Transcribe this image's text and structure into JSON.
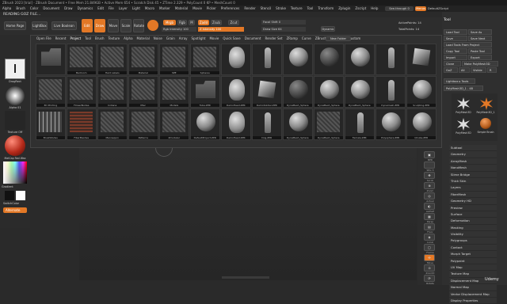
{
  "titlebar": "ZBrush 2023 [trial] - ZBrush Document  •  Free Mem 21.849GB • Active Mem 654 • Scratch Disk 45 • ZTime 2.329 • PolyCount 0 KP • MeshCount 0",
  "menu": [
    "Alpha",
    "Brush",
    "Color",
    "Document",
    "Draw",
    "Dynamics",
    "Edit",
    "File",
    "Layer",
    "Light",
    "Macro",
    "Marker",
    "Material",
    "Movie",
    "Picker",
    "Preferences",
    "Render",
    "Stencil",
    "Stroke",
    "Texture",
    "Tool",
    "Transform",
    "Zplugin",
    "Zscript",
    "Help"
  ],
  "menu_right": {
    "seethrough": "See-through 0",
    "menus": "Menus",
    "default_script": "DefaultZScript"
  },
  "notice": "READING GOZ FILE...",
  "topbar": {
    "home_page": "Home Page",
    "lightbox": "LightBox",
    "live_boolean": "Live Boolean",
    "edit": "Edit",
    "draw": "Draw",
    "move": "Move",
    "scale": "Scale",
    "rotate": "Rotate",
    "mrgb": "Mrgb",
    "rgb": "Rgb",
    "m": "M",
    "zadd": "Zadd",
    "zsub": "Zsub",
    "zcut": "Zcut",
    "rgb_intensity": "Rgb Intensity 100",
    "z_intensity": "Z Intensity 100",
    "focal_shift": "Focal Shift 0",
    "draw_size": "Draw Size 64",
    "dynamic": "Dynamic",
    "active_points": "ActivePoints: 14",
    "total_points": "TotalPoints: 14"
  },
  "lightbox": {
    "tabs": [
      "Open File",
      "Recent",
      "Project",
      "Tool",
      "Brush",
      "Texture",
      "Alpha",
      "Material",
      "Noise",
      "Grain",
      "Array",
      "Spotlight",
      "Movie",
      "Quick Save",
      "Document",
      "Render Set",
      "ZRamp",
      "Curve",
      "ZBrush",
      "Spotlight",
      "Custom"
    ],
    "active_tab": "Project",
    "new_folder": "New Folder",
    "items": [
      {
        "label": "",
        "kind": "folder"
      },
      {
        "label": "Bedroom",
        "kind": "tex"
      },
      {
        "label": "Hard Labels",
        "kind": "tex"
      },
      {
        "label": "Material",
        "kind": "tex"
      },
      {
        "label": "SPE",
        "kind": "tex"
      },
      {
        "label": "Spheres",
        "kind": "tex"
      },
      {
        "label": "",
        "kind": "head"
      },
      {
        "label": "",
        "kind": "figure"
      },
      {
        "label": "",
        "kind": "sphere"
      },
      {
        "label": "",
        "kind": "sphere"
      },
      {
        "label": "",
        "kind": "sphere"
      },
      {
        "label": "",
        "kind": "figure"
      },
      {
        "label": "",
        "kind": "cube"
      },
      {
        "label": "3D Printing",
        "kind": "tex"
      },
      {
        "label": "FlowerNodes",
        "kind": "tex"
      },
      {
        "label": "Indiana",
        "kind": "tex"
      },
      {
        "label": "Misc",
        "kind": "tex"
      },
      {
        "label": "Models",
        "kind": "tex"
      },
      {
        "label": "Tube.ZPR",
        "kind": "folder"
      },
      {
        "label": "DemoHead.ZPR",
        "kind": "head"
      },
      {
        "label": "DemoSoldier.ZPR",
        "kind": "cube"
      },
      {
        "label": "DynaMesh_Sphere",
        "kind": "sphere"
      },
      {
        "label": "DynaMesh_Sphere",
        "kind": "sphere"
      },
      {
        "label": "DynaMesh_Sphere",
        "kind": "sphere"
      },
      {
        "label": "Dynamesh.ZPR",
        "kind": "figure"
      },
      {
        "label": "Sculpting.ZPR",
        "kind": "sphere"
      },
      {
        "label": "BrushNodes",
        "kind": "brush"
      },
      {
        "label": "FiberMeshes",
        "kind": "red"
      },
      {
        "label": "Mannequin",
        "kind": "tex"
      },
      {
        "label": "Patterns",
        "kind": "tex"
      },
      {
        "label": "Zmodeler",
        "kind": "tex"
      },
      {
        "label": "DefaultProject.ZPR",
        "kind": "sphere"
      },
      {
        "label": "DemoHead.ZPR",
        "kind": "head"
      },
      {
        "label": "Dog.ZPR",
        "kind": "figure"
      },
      {
        "label": "DynaMesh_Sphere",
        "kind": "sphere"
      },
      {
        "label": "DynaMesh_Sphere",
        "kind": "tex"
      },
      {
        "label": "Female.ZPR",
        "kind": "figure"
      },
      {
        "label": "Polysphere.ZPR",
        "kind": "sphere"
      },
      {
        "label": "QCube.ZPR",
        "kind": "sphere"
      }
    ]
  },
  "leftshelf": {
    "stroke": "DragRect",
    "alpha": "Alpha 01",
    "texture": "Texture Off",
    "material": "MatCap Red Wax",
    "gradient": "Gradient",
    "switch_color": "SwitchColor",
    "alternate": "Alternate"
  },
  "rightpanel": {
    "title": "Tool",
    "buttons": [
      "Load Tool",
      "Save As",
      "Save",
      "Save Next",
      "Load Tools From Project",
      "Copy Tool",
      "Paste Tool",
      "Import",
      "Export",
      "Clone",
      "Make PolyMesh3D",
      "GoZ",
      "All",
      "Visible",
      "R",
      "Lightbox ▸ Tools",
      "PolyMesh3D_1 . 48"
    ],
    "tools": [
      "PolyMesh3D",
      "PolyMesh3D_1",
      "Simple Brush",
      "PolyMesh3D"
    ],
    "subpalettes": [
      "Subtool",
      "Geometry",
      "ArrayMesh",
      "NanoMesh",
      "Slime Bridge",
      "Thick Skin",
      "Layers",
      "FiberMesh",
      "Geometry HD",
      "Preview",
      "Surface",
      "Deformation",
      "Masking",
      "Visibility",
      "Polygroups",
      "Contact",
      "Morph Target",
      "Polypaint",
      "UV Map",
      "Texture Map",
      "Displacement Map",
      "Normal Map",
      "Vector Displacement Map",
      "Display Properties"
    ]
  },
  "rightshelf": [
    {
      "label": "BPR",
      "icon": "▣"
    },
    {
      "label": "SPix 3",
      "icon": ""
    },
    {
      "label": "Scroll",
      "icon": "✥"
    },
    {
      "label": "Zoom",
      "icon": "⊕"
    },
    {
      "label": "Actual",
      "icon": "◎"
    },
    {
      "label": "AAHalf",
      "icon": "◐"
    },
    {
      "label": "Persp",
      "icon": "▦"
    },
    {
      "label": "Floor",
      "icon": "▤"
    },
    {
      "label": "Local",
      "icon": "◈"
    },
    {
      "label": "Frame",
      "icon": "▢"
    },
    {
      "label": "Move",
      "icon": "✣"
    },
    {
      "label": "ZoomD",
      "icon": "⊙"
    },
    {
      "label": "Rotate",
      "icon": "⟳"
    }
  ],
  "watermark": "Udemy"
}
